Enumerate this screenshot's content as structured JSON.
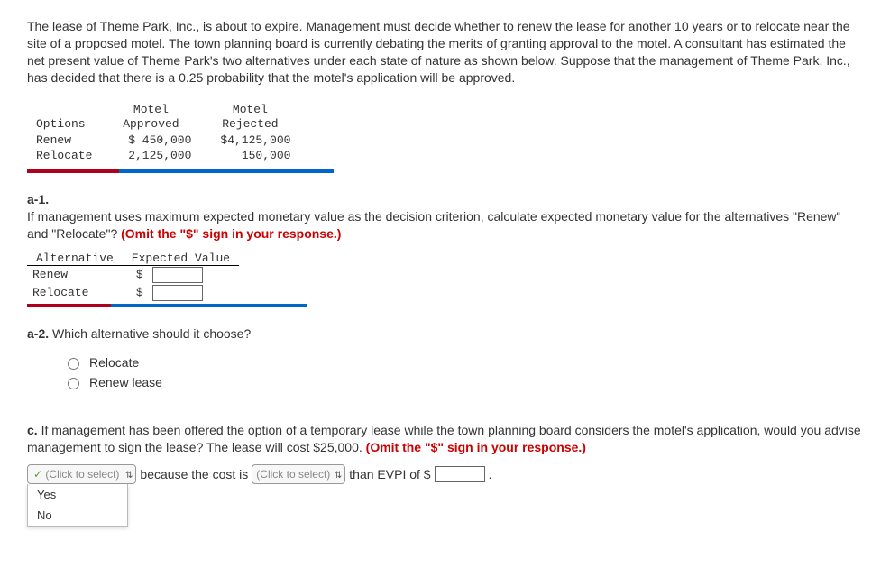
{
  "intro": "The lease of Theme Park, Inc., is about to expire. Management must decide whether to renew the lease for another 10 years or to relocate near the site of a proposed motel. The town planning board is currently debating the merits of granting approval to the motel. A consultant has estimated the net present value of Theme Park's two alternatives under each state of nature as shown below. Suppose that the management of Theme Park, Inc., has decided that there is a 0.25 probability that the motel's application will be approved.",
  "payoff": {
    "col_options": "Options",
    "col_approved_top": "Motel",
    "col_approved_bot": "Approved",
    "col_rejected_top": "Motel",
    "col_rejected_bot": "Rejected",
    "rows": [
      {
        "opt": "Renew",
        "approved": "$  450,000",
        "rejected": "$4,125,000"
      },
      {
        "opt": "Relocate",
        "approved": "2,125,000",
        "rejected": "150,000"
      }
    ]
  },
  "a1": {
    "label": "a-1.",
    "text_before": "If management uses maximum expected monetary value as the decision criterion, calculate expected monetary value for the alternatives \"Renew\" and \"Relocate\"? ",
    "note": "(Omit the \"$\" sign in your response.)",
    "col_alt": "Alternative",
    "col_ev": "Expected Value",
    "rows": [
      {
        "alt": "Renew",
        "sym": "$"
      },
      {
        "alt": "Relocate",
        "sym": "$"
      }
    ]
  },
  "a2": {
    "label": "a-2.",
    "text": " Which alternative should it choose?",
    "opt1": "Relocate",
    "opt2": "Renew lease"
  },
  "c": {
    "label": "c.",
    "text_before": " If management has been offered the option of a temporary lease while the town planning board considers the motel's application, would you advise management to sign the lease? The lease will cost $25,000. ",
    "note": "(Omit the \"$\" sign in your response.)",
    "select1_placeholder": "(Click to select)",
    "select1_opts": [
      "Yes",
      "No"
    ],
    "mid1": " because the cost is ",
    "select2_placeholder": "(Click to select)",
    "mid2": " than EVPI of $ ",
    "period": "."
  }
}
